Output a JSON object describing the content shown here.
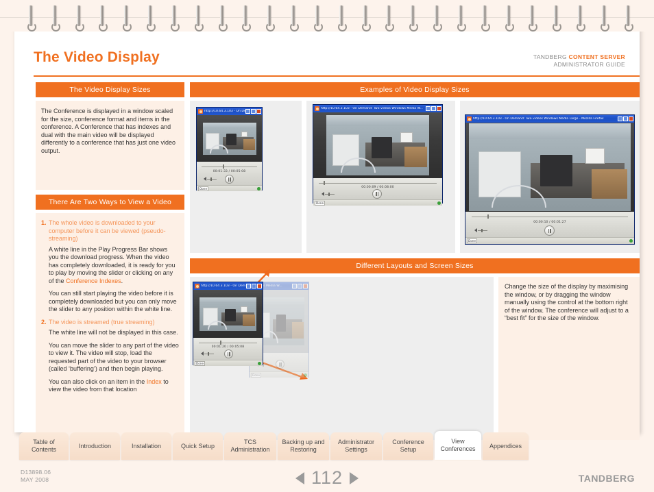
{
  "colors": {
    "accent": "#f07020",
    "panel_tint": "#fdf0e6",
    "page_bg": "#fdf3ec",
    "muted_text": "#9a9a9a"
  },
  "header": {
    "title": "The Video Display",
    "doc_brand_prefix": "TANDBERG ",
    "doc_brand_product": "CONTENT SERVER",
    "doc_subtitle": "ADMINISTRATOR GUIDE"
  },
  "left_column": {
    "sizes_bar": "The Video Display Sizes",
    "sizes_body": "The Conference is displayed in a window scaled for the size, conference format and items in the conference. A Conference that has indexes and dual with the main video will be displayed differently to a conference that has just one video output.",
    "twoways_bar": "There Are Two Ways to View a Video",
    "items": [
      {
        "number": "1.",
        "title": "The whole video is downloaded to your computer before it can be viewed (pseudo-streaming)",
        "paragraphs": [
          {
            "pre": "A white line in the Play Progress Bar shows you the download progress. When the video has completely downloaded, it is ready for you to play by moving the slider or clicking on any of the ",
            "link": "Conference Indexes",
            "post": "."
          },
          {
            "pre": "You can still start playing the video before it is completely downloaded but you can only move the slider to any position within the white line.",
            "link": "",
            "post": ""
          }
        ]
      },
      {
        "number": "2.",
        "title": "The video is streamed (true streaming)",
        "paragraphs": [
          {
            "pre": "The white line will not be displayed in this case.",
            "link": "",
            "post": ""
          },
          {
            "pre": "You can move the slider to any part of the video to view it. The video will stop, load the requested part of the video to your browser (called ‘buffering’) and then begin playing.",
            "link": "",
            "post": ""
          },
          {
            "pre": "You can also click on an item in the ",
            "link": "Index",
            "post": " to view the video from that location"
          }
        ]
      }
    ]
  },
  "examples": {
    "bar": "Examples of Video Display Sizes",
    "windows": [
      {
        "title": "http://10.64.3.103 - On Dem...",
        "time": "00:01:33 / 00:05:08",
        "status": "Done"
      },
      {
        "title": "http://10.64.3.103 - On Demand: Two videos Windows Media W...",
        "time": "00:00:09 / 00:08:00",
        "status": "Done"
      },
      {
        "title": "http://10.64.3.103 - On Demand: Two videos Windows Media Large - Mozilla Firefox",
        "time": "00:00:10 / 00:01:27",
        "status": "Done"
      }
    ]
  },
  "layouts": {
    "bar": "Different Layouts and Screen Sizes",
    "front_window": {
      "title": "http://10.64.3.103 - On Dem...",
      "time": "00:01:20 / 00:05:08",
      "status": "Done"
    },
    "back_window": {
      "title": "Windows Media W...",
      "status": "Done"
    },
    "body": "Change the size of the display by maximising the window, or by dragging the window manually using the control at the bottom right of the window. The conference will adjust to a “best fit” for the size of the window."
  },
  "tabs": [
    {
      "label": "Table of Contents",
      "active": false
    },
    {
      "label": "Introduction",
      "active": false
    },
    {
      "label": "Installation",
      "active": false
    },
    {
      "label": "Quick Setup",
      "active": false
    },
    {
      "label": "TCS Administration",
      "active": false
    },
    {
      "label": "Backing up and Restoring",
      "active": false
    },
    {
      "label": "Administrator Settings",
      "active": false
    },
    {
      "label": "Conference Setup",
      "active": false
    },
    {
      "label": "View Conferences",
      "active": true
    },
    {
      "label": "Appendices",
      "active": false
    }
  ],
  "footer": {
    "doc_number": "D13898.06",
    "doc_date": "MAY 2008",
    "page_number": "112",
    "brand": "TANDBERG"
  }
}
